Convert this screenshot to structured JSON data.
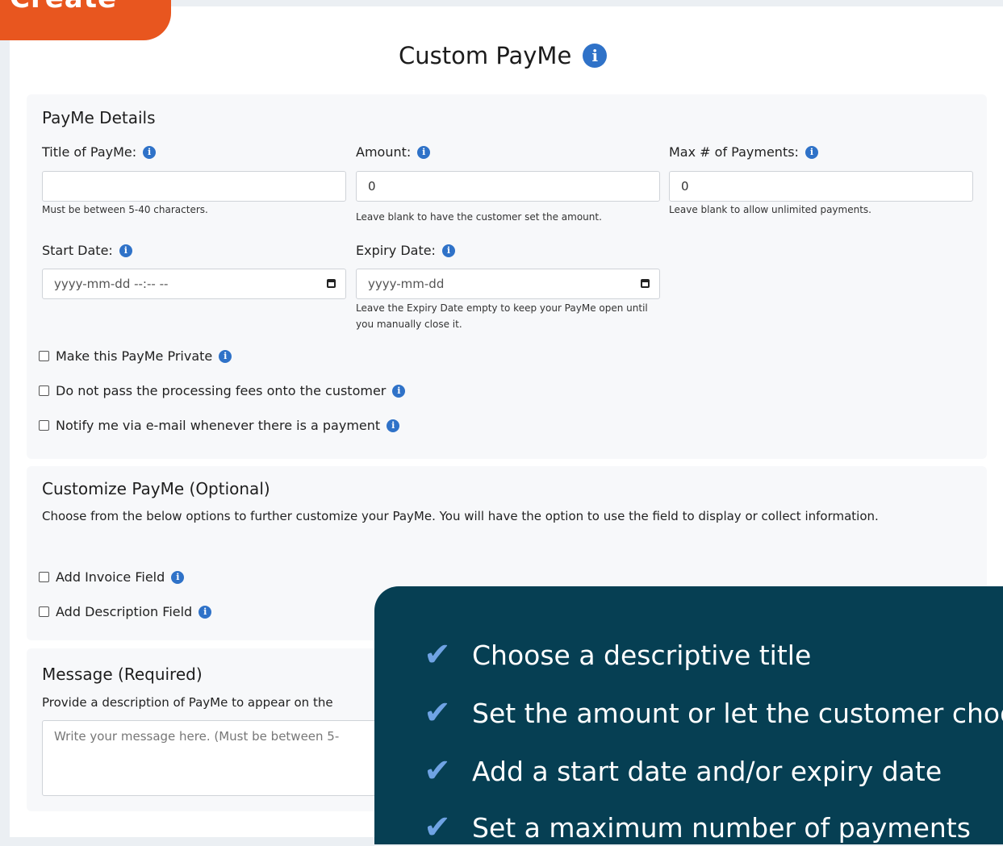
{
  "corner_tab": {
    "label": "Create"
  },
  "page_title": "Custom PayMe",
  "details": {
    "heading": "PayMe Details",
    "title_label": "Title of PayMe:",
    "title_value": "",
    "title_hint": "Must be between 5-40 characters.",
    "amount_label": "Amount:",
    "amount_value": "0",
    "amount_hint": "Leave blank to have the customer set the amount.",
    "max_label": "Max # of Payments:",
    "max_value": "0",
    "max_hint": "Leave blank to allow unlimited payments.",
    "start_label": "Start Date:",
    "start_placeholder": "yyyy-mm-dd --:-- --",
    "expiry_label": "Expiry Date:",
    "expiry_placeholder": "yyyy-mm-dd",
    "expiry_hint": "Leave the Expiry Date empty to keep your PayMe open until you manually close it.",
    "options": [
      {
        "label": "Make this PayMe Private",
        "checked": false
      },
      {
        "label": "Do not pass the processing fees onto the customer",
        "checked": false
      },
      {
        "label": "Notify me via e-mail whenever there is a payment",
        "checked": false
      }
    ]
  },
  "customize": {
    "heading": "Customize PayMe (Optional)",
    "description": "Choose from the below options to further customize your PayMe. You will have the option to use the field to display or collect information.",
    "options": [
      {
        "label": "Add Invoice Field",
        "checked": false
      },
      {
        "label": "Add Description Field",
        "checked": false
      }
    ]
  },
  "message": {
    "heading": "Message (Required)",
    "description": "Provide a description of PayMe to appear on the",
    "placeholder": "Write your message here. (Must be between 5-"
  },
  "tips": [
    "Choose a descriptive title",
    "Set the amount or let the customer choos",
    "Add a start date and/or expiry date",
    "Set a maximum number of payments"
  ],
  "colors": {
    "accent": "#e8561f",
    "info": "#2f72c8",
    "overlay": "#063f53",
    "check": "#6fa3e4"
  }
}
